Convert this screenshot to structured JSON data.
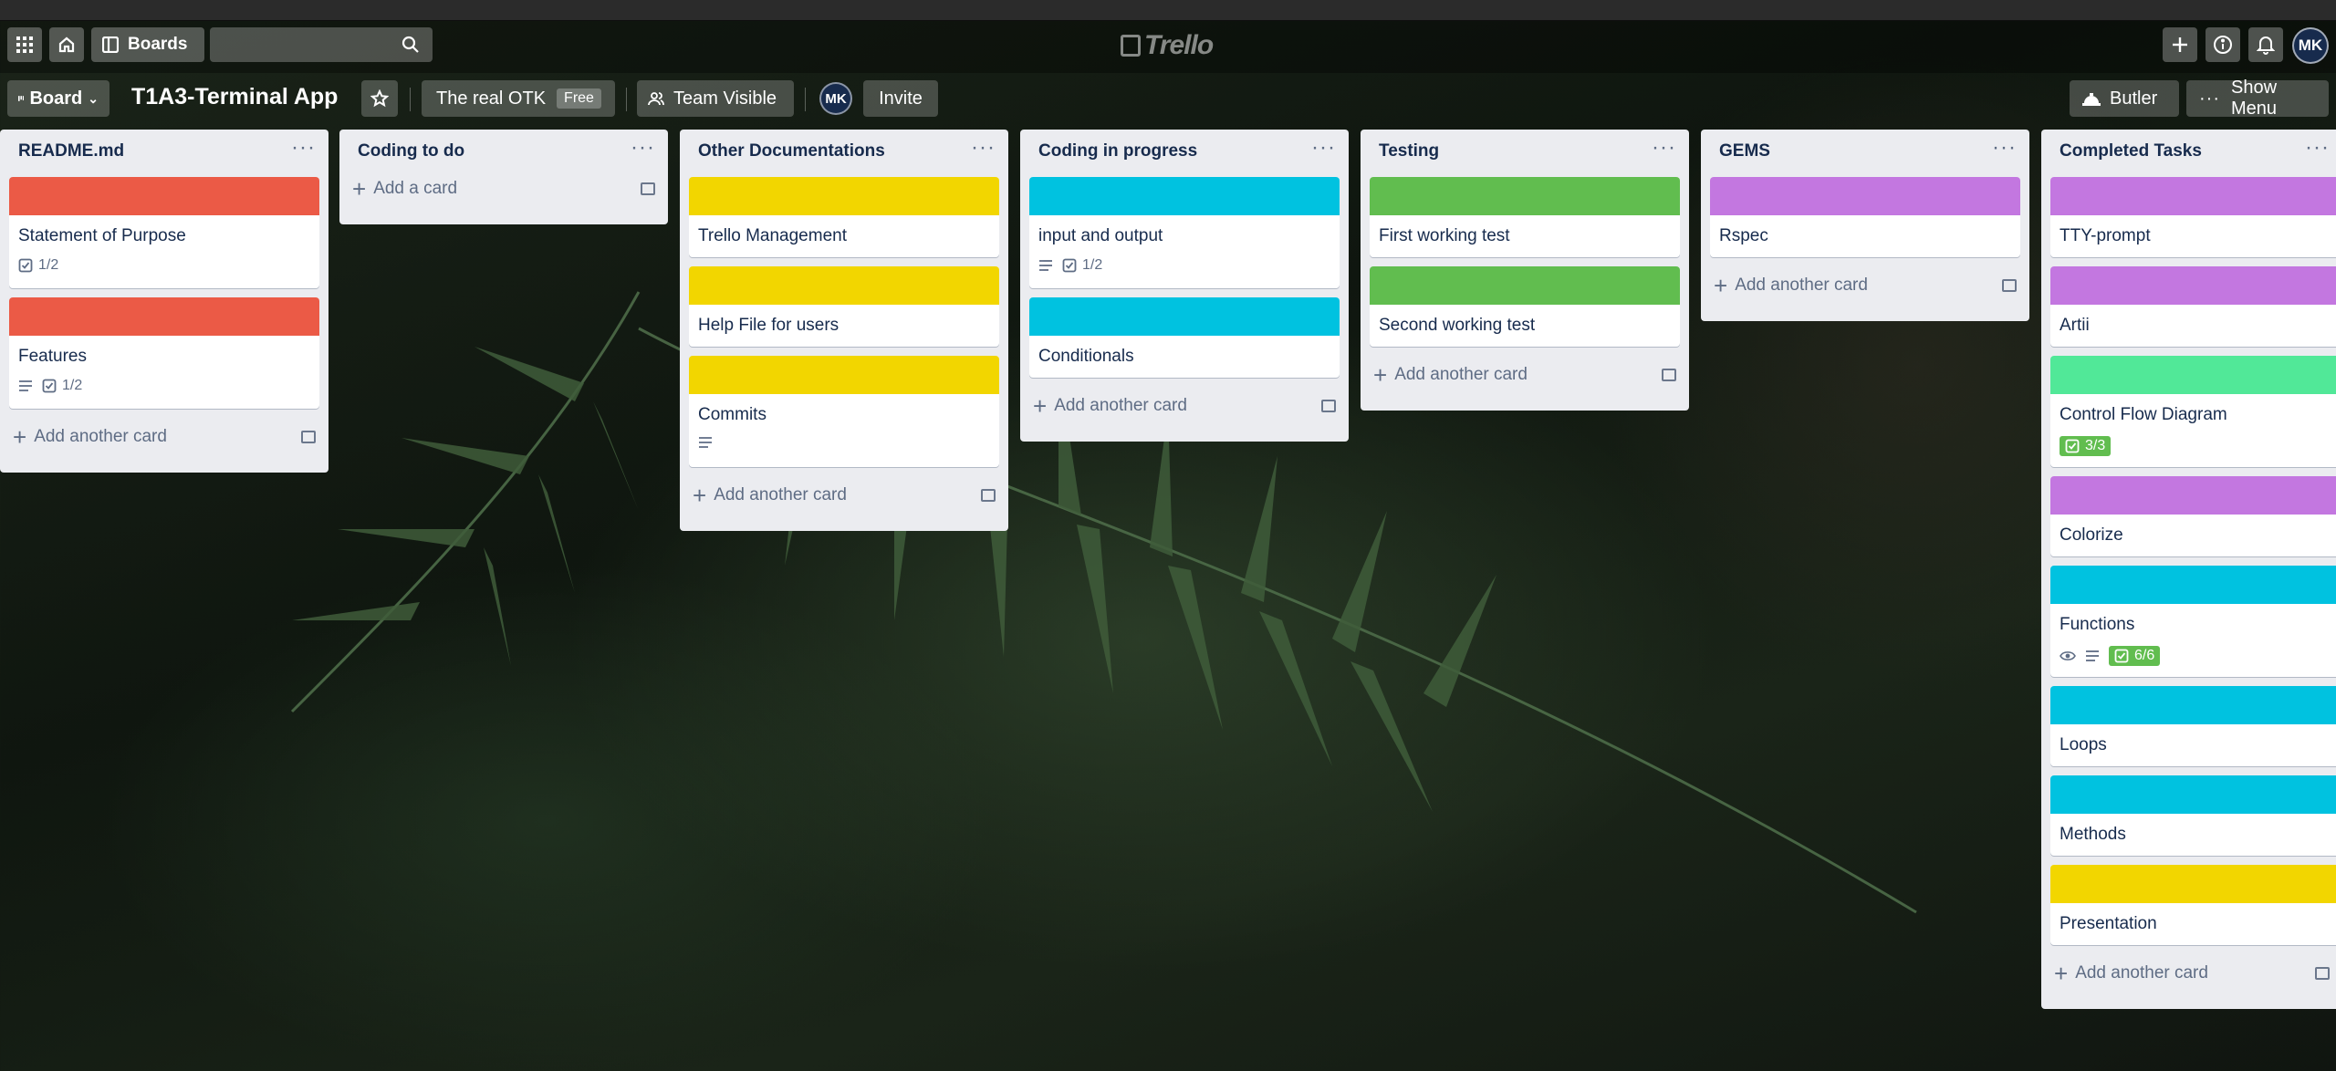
{
  "header": {
    "boards_label": "Boards",
    "search_value": "",
    "logo_text": "Trello",
    "avatar_initials": "MK"
  },
  "board_bar": {
    "view_label": "Board",
    "title": "T1A3-Terminal App",
    "workspace": "The real OTK",
    "plan_badge": "Free",
    "visibility": "Team Visible",
    "member_initials": "MK",
    "invite_label": "Invite",
    "butler_label": "Butler",
    "menu_label": "Show Menu"
  },
  "colors": {
    "red": "#eb5a46",
    "yellow": "#f2d600",
    "sky": "#00c2e0",
    "green": "#61bd4f",
    "purple": "#c377e0",
    "lime": "#51e898"
  },
  "lists": [
    {
      "title": "README.md",
      "add_label": "Add another card",
      "cards": [
        {
          "title": "Statement of Purpose",
          "label": "red",
          "checklist": "1/2"
        },
        {
          "title": "Features",
          "label": "red",
          "checklist": "1/2"
        }
      ]
    },
    {
      "title": "Coding to do",
      "add_label": "Add a card",
      "cards": []
    },
    {
      "title": "Other Documentations",
      "add_label": "Add another card",
      "cards": [
        {
          "title": "Trello Management",
          "label": "yellow"
        },
        {
          "title": "Help File for users",
          "label": "yellow"
        },
        {
          "title": "Commits",
          "label": "yellow"
        }
      ]
    },
    {
      "title": "Coding in progress",
      "add_label": "Add another card",
      "cards": [
        {
          "title": "input and output",
          "label": "sky",
          "checklist": "1/2"
        },
        {
          "title": "Conditionals",
          "label": "sky"
        }
      ]
    },
    {
      "title": "Testing",
      "add_label": "Add another card",
      "cards": [
        {
          "title": "First working test",
          "label": "green"
        },
        {
          "title": "Second working test",
          "label": "green"
        }
      ]
    },
    {
      "title": "GEMS",
      "add_label": "Add another card",
      "cards": [
        {
          "title": "Rspec",
          "label": "purple"
        }
      ]
    },
    {
      "title": "Completed Tasks",
      "add_label": "Add another card",
      "cards": [
        {
          "title": "TTY-prompt",
          "label": "purple"
        },
        {
          "title": "Artii",
          "label": "purple"
        },
        {
          "title": "Control Flow Diagram",
          "label": "lime",
          "checklist": "3/3"
        },
        {
          "title": "Colorize",
          "label": "purple"
        },
        {
          "title": "Functions",
          "label": "sky",
          "checklist": "6/6"
        },
        {
          "title": "Loops",
          "label": "sky"
        },
        {
          "title": "Methods",
          "label": "sky"
        },
        {
          "title": "Presentation",
          "label": "yellow"
        }
      ]
    }
  ]
}
